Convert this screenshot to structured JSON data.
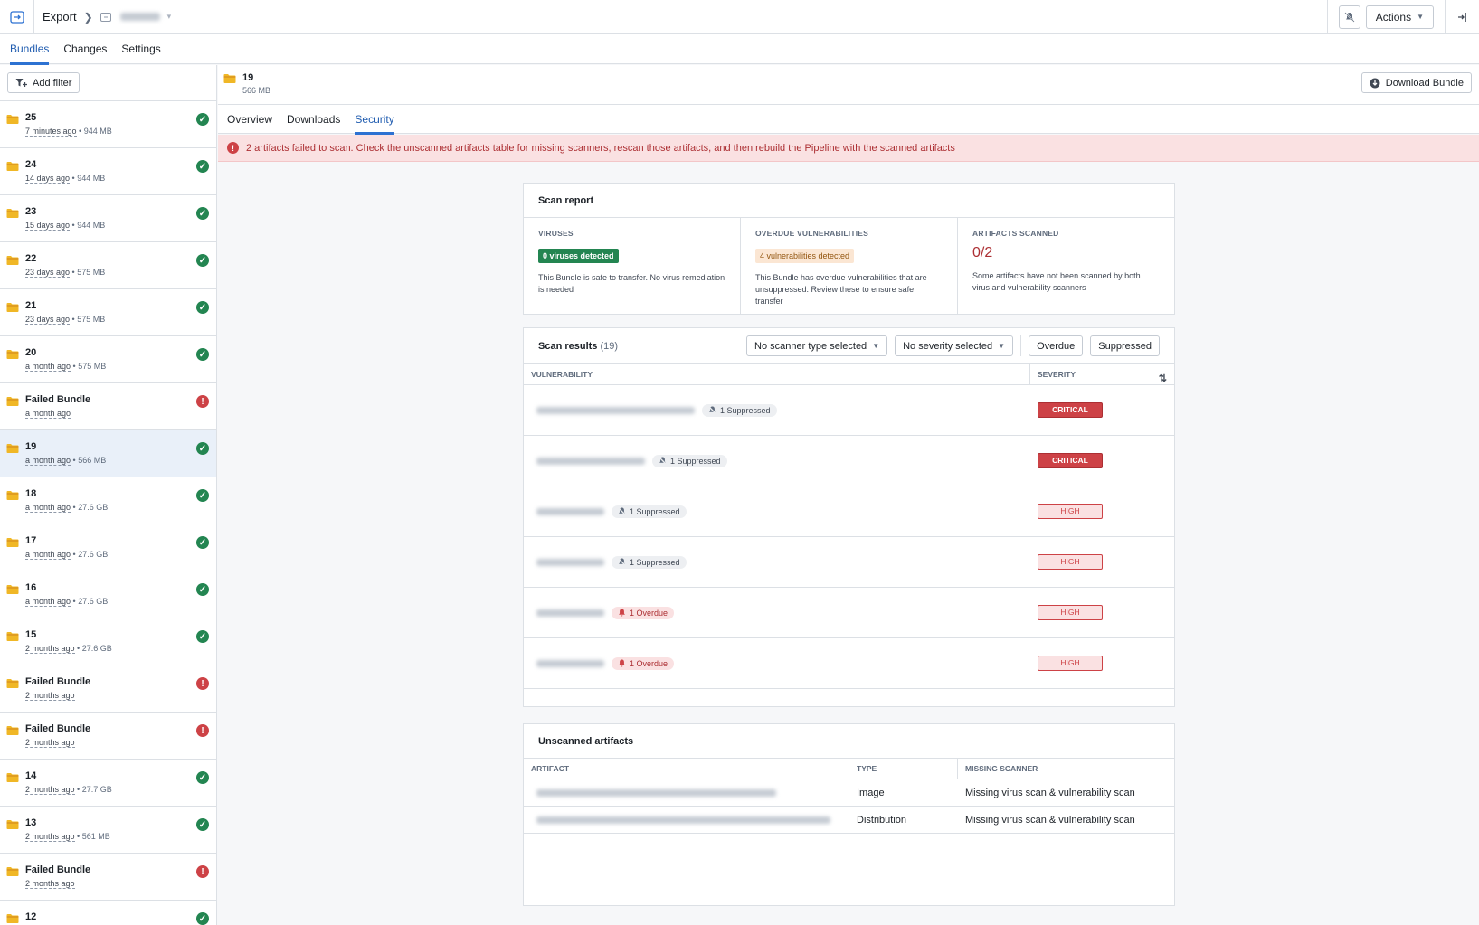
{
  "topbar": {
    "breadcrumb_root": "Export",
    "actions_label": "Actions"
  },
  "tabs": [
    {
      "label": "Bundles",
      "active": true
    },
    {
      "label": "Changes",
      "active": false
    },
    {
      "label": "Settings",
      "active": false
    }
  ],
  "sidebar": {
    "add_filter_label": "Add filter",
    "bundles": [
      {
        "name": "25",
        "ago": "7 minutes ago",
        "size": "944 MB",
        "status": "ok"
      },
      {
        "name": "24",
        "ago": "14 days ago",
        "size": "944 MB",
        "status": "ok"
      },
      {
        "name": "23",
        "ago": "15 days ago",
        "size": "944 MB",
        "status": "ok"
      },
      {
        "name": "22",
        "ago": "23 days ago",
        "size": "575 MB",
        "status": "ok"
      },
      {
        "name": "21",
        "ago": "23 days ago",
        "size": "575 MB",
        "status": "ok"
      },
      {
        "name": "20",
        "ago": "a month ago",
        "size": "575 MB",
        "status": "ok"
      },
      {
        "name": "Failed Bundle",
        "ago": "a month ago",
        "size": "",
        "status": "err"
      },
      {
        "name": "19",
        "ago": "a month ago",
        "size": "566 MB",
        "status": "ok",
        "selected": true
      },
      {
        "name": "18",
        "ago": "a month ago",
        "size": "27.6 GB",
        "status": "ok"
      },
      {
        "name": "17",
        "ago": "a month ago",
        "size": "27.6 GB",
        "status": "ok"
      },
      {
        "name": "16",
        "ago": "a month ago",
        "size": "27.6 GB",
        "status": "ok"
      },
      {
        "name": "15",
        "ago": "2 months ago",
        "size": "27.6 GB",
        "status": "ok"
      },
      {
        "name": "Failed Bundle",
        "ago": "2 months ago",
        "size": "",
        "status": "err"
      },
      {
        "name": "Failed Bundle",
        "ago": "2 months ago",
        "size": "",
        "status": "err"
      },
      {
        "name": "14",
        "ago": "2 months ago",
        "size": "27.7 GB",
        "status": "ok"
      },
      {
        "name": "13",
        "ago": "2 months ago",
        "size": "561 MB",
        "status": "ok"
      },
      {
        "name": "Failed Bundle",
        "ago": "2 months ago",
        "size": "",
        "status": "err"
      },
      {
        "name": "12",
        "ago": "",
        "size": "",
        "status": "ok"
      }
    ]
  },
  "bundle_header": {
    "name": "19",
    "size": "566 MB",
    "download_label": "Download Bundle"
  },
  "main_tabs": [
    {
      "label": "Overview",
      "active": false
    },
    {
      "label": "Downloads",
      "active": false
    },
    {
      "label": "Security",
      "active": true
    }
  ],
  "alert": {
    "text": "2 artifacts failed to scan. Check the unscanned artifacts table for missing scanners, rescan those artifacts, and then rebuild the Pipeline with the scanned artifacts"
  },
  "scan_report": {
    "title": "Scan report",
    "viruses": {
      "label": "VIRUSES",
      "tag": "0 viruses detected",
      "desc": "This Bundle is safe to transfer. No virus remediation is needed"
    },
    "vulnerabilities": {
      "label": "OVERDUE VULNERABILITIES",
      "tag": "4 vulnerabilities detected",
      "desc": "This Bundle has overdue vulnerabilities that are unsuppressed. Review these to ensure safe transfer"
    },
    "artifacts": {
      "label": "ARTIFACTS SCANNED",
      "value": "0/2",
      "desc": "Some artifacts have not been scanned by both virus and vulnerability scanners"
    }
  },
  "scan_results": {
    "title": "Scan results",
    "count": "(19)",
    "scanner_filter": "No scanner type selected",
    "severity_filter": "No severity selected",
    "overdue_label": "Overdue",
    "suppressed_label": "Suppressed",
    "col_vulnerability": "VULNERABILITY",
    "col_severity": "SEVERITY",
    "rows": [
      {
        "badge": "1 Suppressed",
        "badge_type": "suppressed",
        "severity": "CRITICAL"
      },
      {
        "badge": "1 Suppressed",
        "badge_type": "suppressed",
        "severity": "CRITICAL"
      },
      {
        "badge": "1 Suppressed",
        "badge_type": "suppressed",
        "severity": "HIGH"
      },
      {
        "badge": "1 Suppressed",
        "badge_type": "suppressed",
        "severity": "HIGH"
      },
      {
        "badge": "1 Overdue",
        "badge_type": "overdue",
        "severity": "HIGH"
      },
      {
        "badge": "1 Overdue",
        "badge_type": "overdue",
        "severity": "HIGH"
      }
    ]
  },
  "unscanned": {
    "title": "Unscanned artifacts",
    "col_artifact": "ARTIFACT",
    "col_type": "TYPE",
    "col_missing": "MISSING SCANNER",
    "rows": [
      {
        "type": "Image",
        "missing": "Missing virus scan & vulnerability scan"
      },
      {
        "type": "Distribution",
        "missing": "Missing virus scan & vulnerability scan"
      }
    ]
  },
  "colors": {
    "accent": "#2d72d2",
    "success": "#238551",
    "danger": "#cd4246",
    "folder": "#f0b726"
  }
}
